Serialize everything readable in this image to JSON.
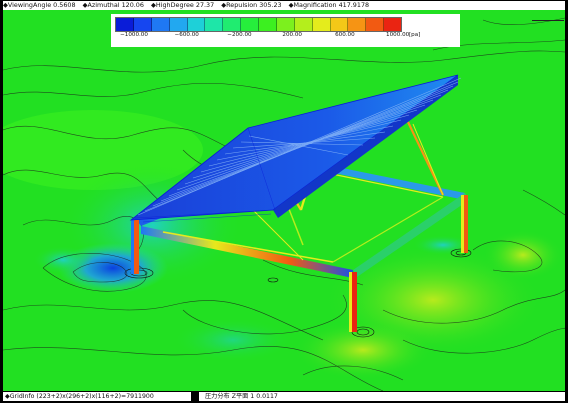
{
  "header": {
    "viewing_angle": "◆ViewingAngle  0.5608",
    "azimuth": "◆Azimuthal 120.06",
    "high_degree": "◆HighDegree 27.37",
    "repulsion": "◆Repulsion 305.23",
    "magnification": "◆Magnification 417.9178"
  },
  "colorbar": {
    "ticks": [
      "−1000.00",
      "−600.00",
      "−200.00",
      "200.00",
      "600.00",
      "1000.00"
    ],
    "tick_values": [
      -1000,
      -600,
      -200,
      200,
      600,
      1000
    ],
    "range": [
      -1000,
      1000
    ],
    "unit": "[pa]",
    "colors": [
      "#0a1cd8",
      "#1646f0",
      "#1f78f4",
      "#22a8f0",
      "#1ed0d8",
      "#1ee6a8",
      "#20ec70",
      "#26ee3c",
      "#3cf020",
      "#7cf01e",
      "#b4ee1c",
      "#e4ec1c",
      "#f4c818",
      "#f69414",
      "#f25a12",
      "#ea2412"
    ]
  },
  "footer": {
    "grid_info": "◆GridInfo  (223+2)x(296+2)x(116+2)=7911900",
    "status": "圧力分布 Z平面  1  0.0117"
  },
  "scene": {
    "background_color": "#22e022",
    "structure_beam_color": "#1a50e6",
    "leg_color": "#e8531a"
  }
}
